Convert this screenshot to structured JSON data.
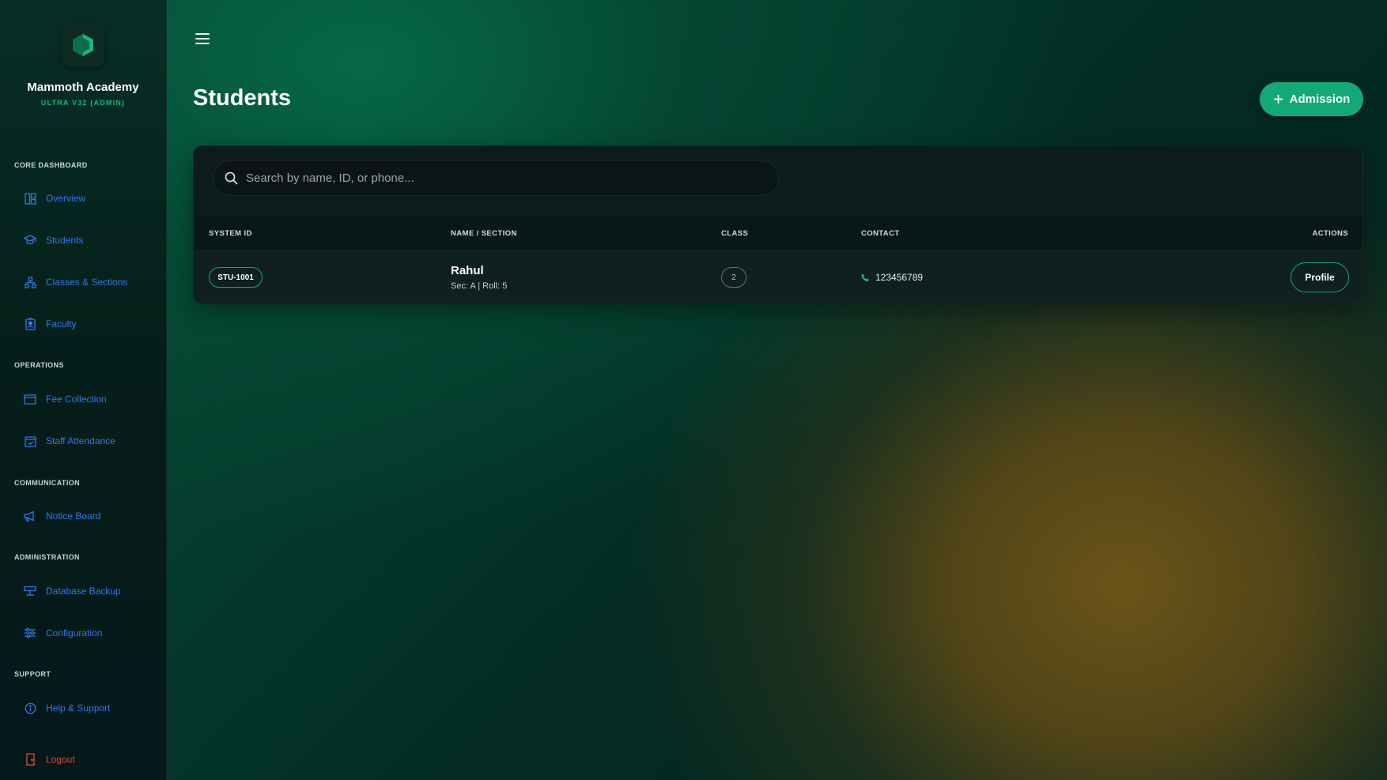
{
  "brand": {
    "name": "Mammoth Academy",
    "subtitle": "ULTRA V32 (ADMIN)",
    "icon": "hexagon-logo-icon"
  },
  "sidebar": {
    "sections": [
      {
        "title": "CORE DASHBOARD",
        "items": [
          {
            "label": "Overview",
            "icon": "dashboard-icon"
          },
          {
            "label": "Students",
            "icon": "graduation-cap-icon"
          },
          {
            "label": "Classes & Sections",
            "icon": "hierarchy-icon"
          },
          {
            "label": "Faculty",
            "icon": "id-badge-icon"
          }
        ]
      },
      {
        "title": "OPERATIONS",
        "items": [
          {
            "label": "Fee Collection",
            "icon": "wallet-icon"
          },
          {
            "label": "Staff Attendance",
            "icon": "calendar-check-icon"
          }
        ]
      },
      {
        "title": "COMMUNICATION",
        "items": [
          {
            "label": "Notice Board",
            "icon": "megaphone-icon"
          }
        ]
      },
      {
        "title": "ADMINISTRATION",
        "items": [
          {
            "label": "Database Backup",
            "icon": "server-icon"
          },
          {
            "label": "Configuration",
            "icon": "sliders-icon"
          }
        ]
      },
      {
        "title": "SUPPORT",
        "items": [
          {
            "label": "Help & Support",
            "icon": "info-circle-icon"
          }
        ]
      }
    ],
    "logout": {
      "label": "Logout",
      "icon": "door-exit-icon"
    }
  },
  "header": {
    "menu_icon": "hamburger-menu-icon",
    "title": "Students"
  },
  "admission_button": {
    "label": "Admission",
    "icon": "plus-icon"
  },
  "search": {
    "placeholder": "Search by name, ID, or phone...",
    "value": "",
    "icon": "search-icon"
  },
  "table": {
    "columns": [
      "SYSTEM ID",
      "NAME / SECTION",
      "CLASS",
      "CONTACT",
      "ACTIONS"
    ],
    "rows": [
      {
        "system_id": "STU-1001",
        "name": "Rahul",
        "section": "Sec: A | Roll: 5",
        "class": "2",
        "contact": "123456789",
        "contact_icon": "phone-icon",
        "action_label": "Profile"
      }
    ]
  },
  "colors": {
    "accent": "#12a878",
    "nav_link": "#2f78f0",
    "logout": "#e0463a",
    "card_bg": "#0c1c1d",
    "sidebar_bg": "#061e19"
  }
}
